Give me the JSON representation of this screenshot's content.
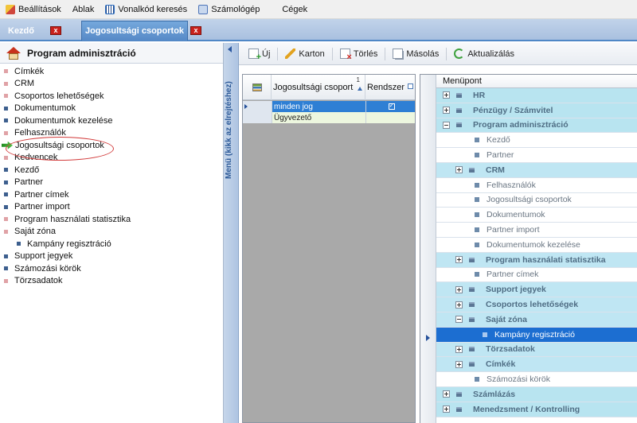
{
  "menubar": {
    "items": [
      {
        "label": "Beállítások",
        "icon": "settings-icon"
      },
      {
        "label": "Ablak",
        "icon": ""
      },
      {
        "label": "Vonalkód keresés",
        "icon": "barcode-icon"
      },
      {
        "label": "Számológép",
        "icon": "calculator-icon"
      },
      {
        "label": "Cégek",
        "icon": ""
      }
    ]
  },
  "tabs": [
    {
      "label": "Kezdő",
      "active": false
    },
    {
      "label": "Jogosultsági csoportok",
      "active": true
    }
  ],
  "left_panel": {
    "title": "Program adminisztráció",
    "items": [
      {
        "label": "Címkék",
        "style": "light"
      },
      {
        "label": "CRM",
        "style": "light"
      },
      {
        "label": "Csoportos lehetőségek",
        "style": "light"
      },
      {
        "label": "Dokumentumok",
        "style": "dark"
      },
      {
        "label": "Dokumentumok kezelése",
        "style": "dark"
      },
      {
        "label": "Felhasználók",
        "style": "light"
      },
      {
        "label": "Jogosultsági csoportok",
        "style": "active"
      },
      {
        "label": "Kedvencek",
        "style": "light"
      },
      {
        "label": "Kezdő",
        "style": "dark"
      },
      {
        "label": "Partner",
        "style": "dark"
      },
      {
        "label": "Partner címek",
        "style": "dark"
      },
      {
        "label": "Partner import",
        "style": "dark"
      },
      {
        "label": "Program használati statisztika",
        "style": "light"
      },
      {
        "label": "Saját zóna",
        "style": "light"
      },
      {
        "label": "Kampány regisztráció",
        "style": "dark-child"
      },
      {
        "label": "Support jegyek",
        "style": "dark"
      },
      {
        "label": "Számozási körök",
        "style": "dark"
      },
      {
        "label": "Törzsadatok",
        "style": "light"
      }
    ]
  },
  "sidebar": {
    "label": "Menü (kikk az elrejtéshez)"
  },
  "toolbar": {
    "new": "Új",
    "edit": "Karton",
    "delete": "Törlés",
    "copy": "Másolás",
    "refresh": "Aktualizálás"
  },
  "groups_grid": {
    "columns": [
      "Jogosultsági csoport",
      "Rendszer"
    ],
    "sort_index": "1",
    "rows": [
      {
        "name": "minden jog",
        "system": true,
        "selected": true
      },
      {
        "name": "Ügyvezető",
        "system": false,
        "selected": false
      }
    ]
  },
  "menu_grid": {
    "header": "Menüpont",
    "rows": [
      {
        "label": "HR",
        "level": 0,
        "expander": "plus"
      },
      {
        "label": "Pénzügy / Számvitel",
        "level": 0,
        "expander": "plus"
      },
      {
        "label": "Program adminisztráció",
        "level": 0,
        "expander": "minus"
      },
      {
        "label": "Kezdő",
        "level": 1,
        "expander": "none"
      },
      {
        "label": "Partner",
        "level": 1,
        "expander": "none"
      },
      {
        "label": "CRM",
        "level": 1,
        "expander": "plus"
      },
      {
        "label": "Felhasználók",
        "level": 1,
        "expander": "none"
      },
      {
        "label": "Jogosultsági csoportok",
        "level": 1,
        "expander": "none"
      },
      {
        "label": "Dokumentumok",
        "level": 1,
        "expander": "none"
      },
      {
        "label": "Partner import",
        "level": 1,
        "expander": "none"
      },
      {
        "label": "Dokumentumok kezelése",
        "level": 1,
        "expander": "none"
      },
      {
        "label": "Program használati statisztika",
        "level": 1,
        "expander": "plus"
      },
      {
        "label": "Partner címek",
        "level": 1,
        "expander": "none"
      },
      {
        "label": "Support jegyek",
        "level": 1,
        "expander": "plus"
      },
      {
        "label": "Csoportos lehetőségek",
        "level": 1,
        "expander": "plus"
      },
      {
        "label": "Saját zóna",
        "level": 1,
        "expander": "minus"
      },
      {
        "label": "Kampány regisztráció",
        "level": 2,
        "expander": "none",
        "selected": true
      },
      {
        "label": "Törzsadatok",
        "level": 1,
        "expander": "plus"
      },
      {
        "label": "Címkék",
        "level": 1,
        "expander": "plus"
      },
      {
        "label": "Számozási körök",
        "level": 1,
        "expander": "none"
      },
      {
        "label": "Számlázás",
        "level": 0,
        "expander": "plus"
      },
      {
        "label": "Menedzsment / Kontrolling",
        "level": 0,
        "expander": "plus"
      }
    ]
  },
  "colors": {
    "accent": "#2e7fd4",
    "tab_active": "#5689c7",
    "tree_group_bg": "#b8e4f0",
    "selection": "#1c6ed1",
    "annotation_ellipse": "#d23a3a"
  }
}
